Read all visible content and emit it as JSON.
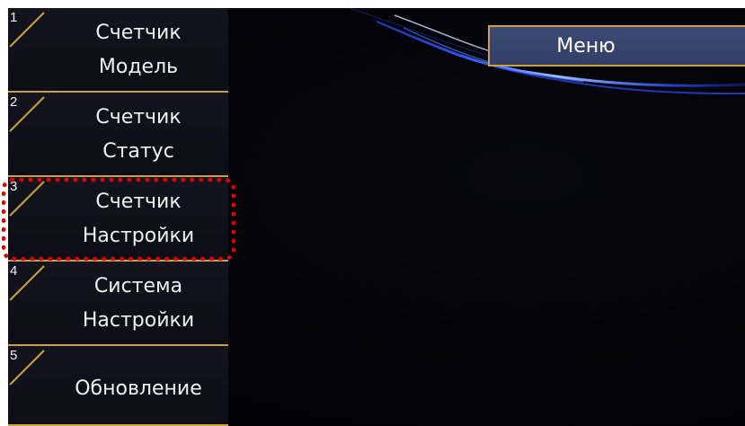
{
  "sidebar": {
    "items": [
      {
        "number": "1",
        "lines": [
          "Счетчик",
          "Модель"
        ]
      },
      {
        "number": "2",
        "lines": [
          "Счетчик",
          "Статус"
        ]
      },
      {
        "number": "3",
        "lines": [
          "Счетчик",
          "Настройки"
        ]
      },
      {
        "number": "4",
        "lines": [
          "Система",
          "Настройки"
        ]
      },
      {
        "number": "5",
        "lines": [
          "Обновление"
        ]
      }
    ],
    "highlighted_item": 3
  },
  "header": {
    "menu_label": "Меню"
  },
  "colors": {
    "accent_gold": "#c9a23a",
    "highlight_red": "#e00000",
    "menu_button": "#3a466f",
    "background": "#030306"
  }
}
